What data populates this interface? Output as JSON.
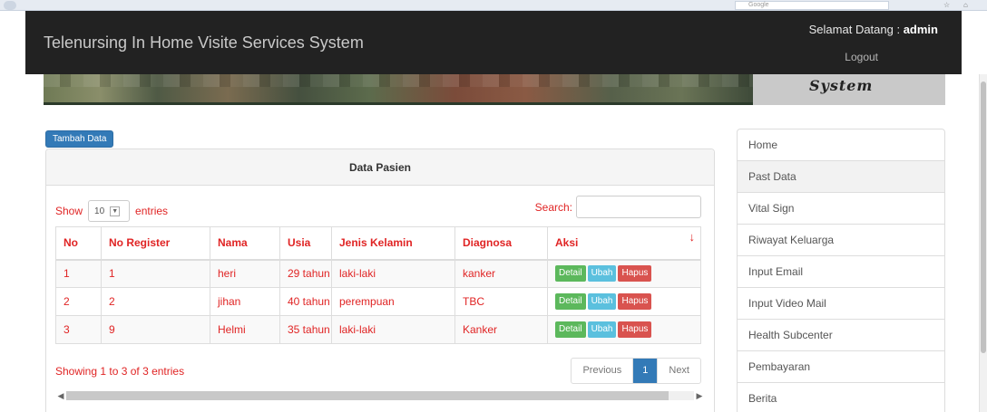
{
  "browser": {
    "search_engine": "Google"
  },
  "navbar": {
    "brand": "Telenursing In Home Visite Services System",
    "welcome_prefix": "Selamat Datang : ",
    "username": "admin",
    "logout_label": "Logout"
  },
  "banner": {
    "side_text": "System"
  },
  "toolbar": {
    "add_label": "Tambah Data"
  },
  "panel": {
    "title": "Data Pasien",
    "show_label": "Show",
    "length_value": "10",
    "entries_label": "entries",
    "search_label": "Search:",
    "search_value": "",
    "info": "Showing 1 to 3 of 3 entries",
    "pagination": {
      "previous": "Previous",
      "current": "1",
      "next": "Next"
    }
  },
  "table": {
    "headers": [
      "No",
      "No Register",
      "Nama",
      "Usia",
      "Jenis Kelamin",
      "Diagnosa",
      "Aksi"
    ],
    "rows": [
      {
        "no": "1",
        "reg": "1",
        "nama": "heri",
        "usia": "29 tahun",
        "jk": "laki-laki",
        "diagnosa": "kanker"
      },
      {
        "no": "2",
        "reg": "2",
        "nama": "jihan",
        "usia": "40 tahun",
        "jk": "perempuan",
        "diagnosa": "TBC"
      },
      {
        "no": "3",
        "reg": "9",
        "nama": "Helmi",
        "usia": "35 tahun",
        "jk": "laki-laki",
        "diagnosa": "Kanker"
      }
    ],
    "actions": {
      "detail": "Detail",
      "ubah": "Ubah",
      "hapus": "Hapus"
    }
  },
  "sidebar": {
    "items": [
      {
        "label": "Home"
      },
      {
        "label": "Past Data"
      },
      {
        "label": "Vital Sign"
      },
      {
        "label": "Riwayat Keluarga"
      },
      {
        "label": "Input Email"
      },
      {
        "label": "Input Video Mail"
      },
      {
        "label": "Health Subcenter"
      },
      {
        "label": "Pembayaran"
      },
      {
        "label": "Berita"
      }
    ]
  },
  "colors": {
    "navbar": "#222222",
    "primary": "#337ab7",
    "text_red": "#e02424",
    "success": "#5cb85c",
    "info": "#5bc0de",
    "danger": "#d9534f"
  }
}
